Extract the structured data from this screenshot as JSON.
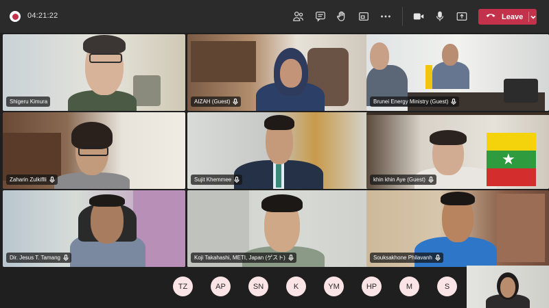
{
  "meeting": {
    "timer": "04:21:22",
    "leave_label": "Leave"
  },
  "toolbar_icons": [
    "people-icon",
    "chat-icon",
    "raise-hand-icon",
    "rooms-icon",
    "more-icon",
    "camera-icon",
    "mic-icon",
    "share-icon"
  ],
  "participants": [
    {
      "name": "Shigeru Kimura",
      "mic": false
    },
    {
      "name": "AIZAH (Guest)",
      "mic": true
    },
    {
      "name": "Brunei Energy Ministry (Guest)",
      "mic": true
    },
    {
      "name": "Zaharin Zulkiflli",
      "mic": true
    },
    {
      "name": "Sujit Khemmee",
      "mic": true
    },
    {
      "name": "khin khin Aye (Guest)",
      "mic": true
    },
    {
      "name": "Dir. Jesus T. Tamang",
      "mic": true
    },
    {
      "name": "Koji Takahashi, METI, Japan (ゲスト)",
      "mic": true
    },
    {
      "name": "Souksakhone Philavanh",
      "mic": true
    }
  ],
  "roster": [
    "TZ",
    "AP",
    "SN",
    "K",
    "YM",
    "HP",
    "M",
    "S"
  ]
}
